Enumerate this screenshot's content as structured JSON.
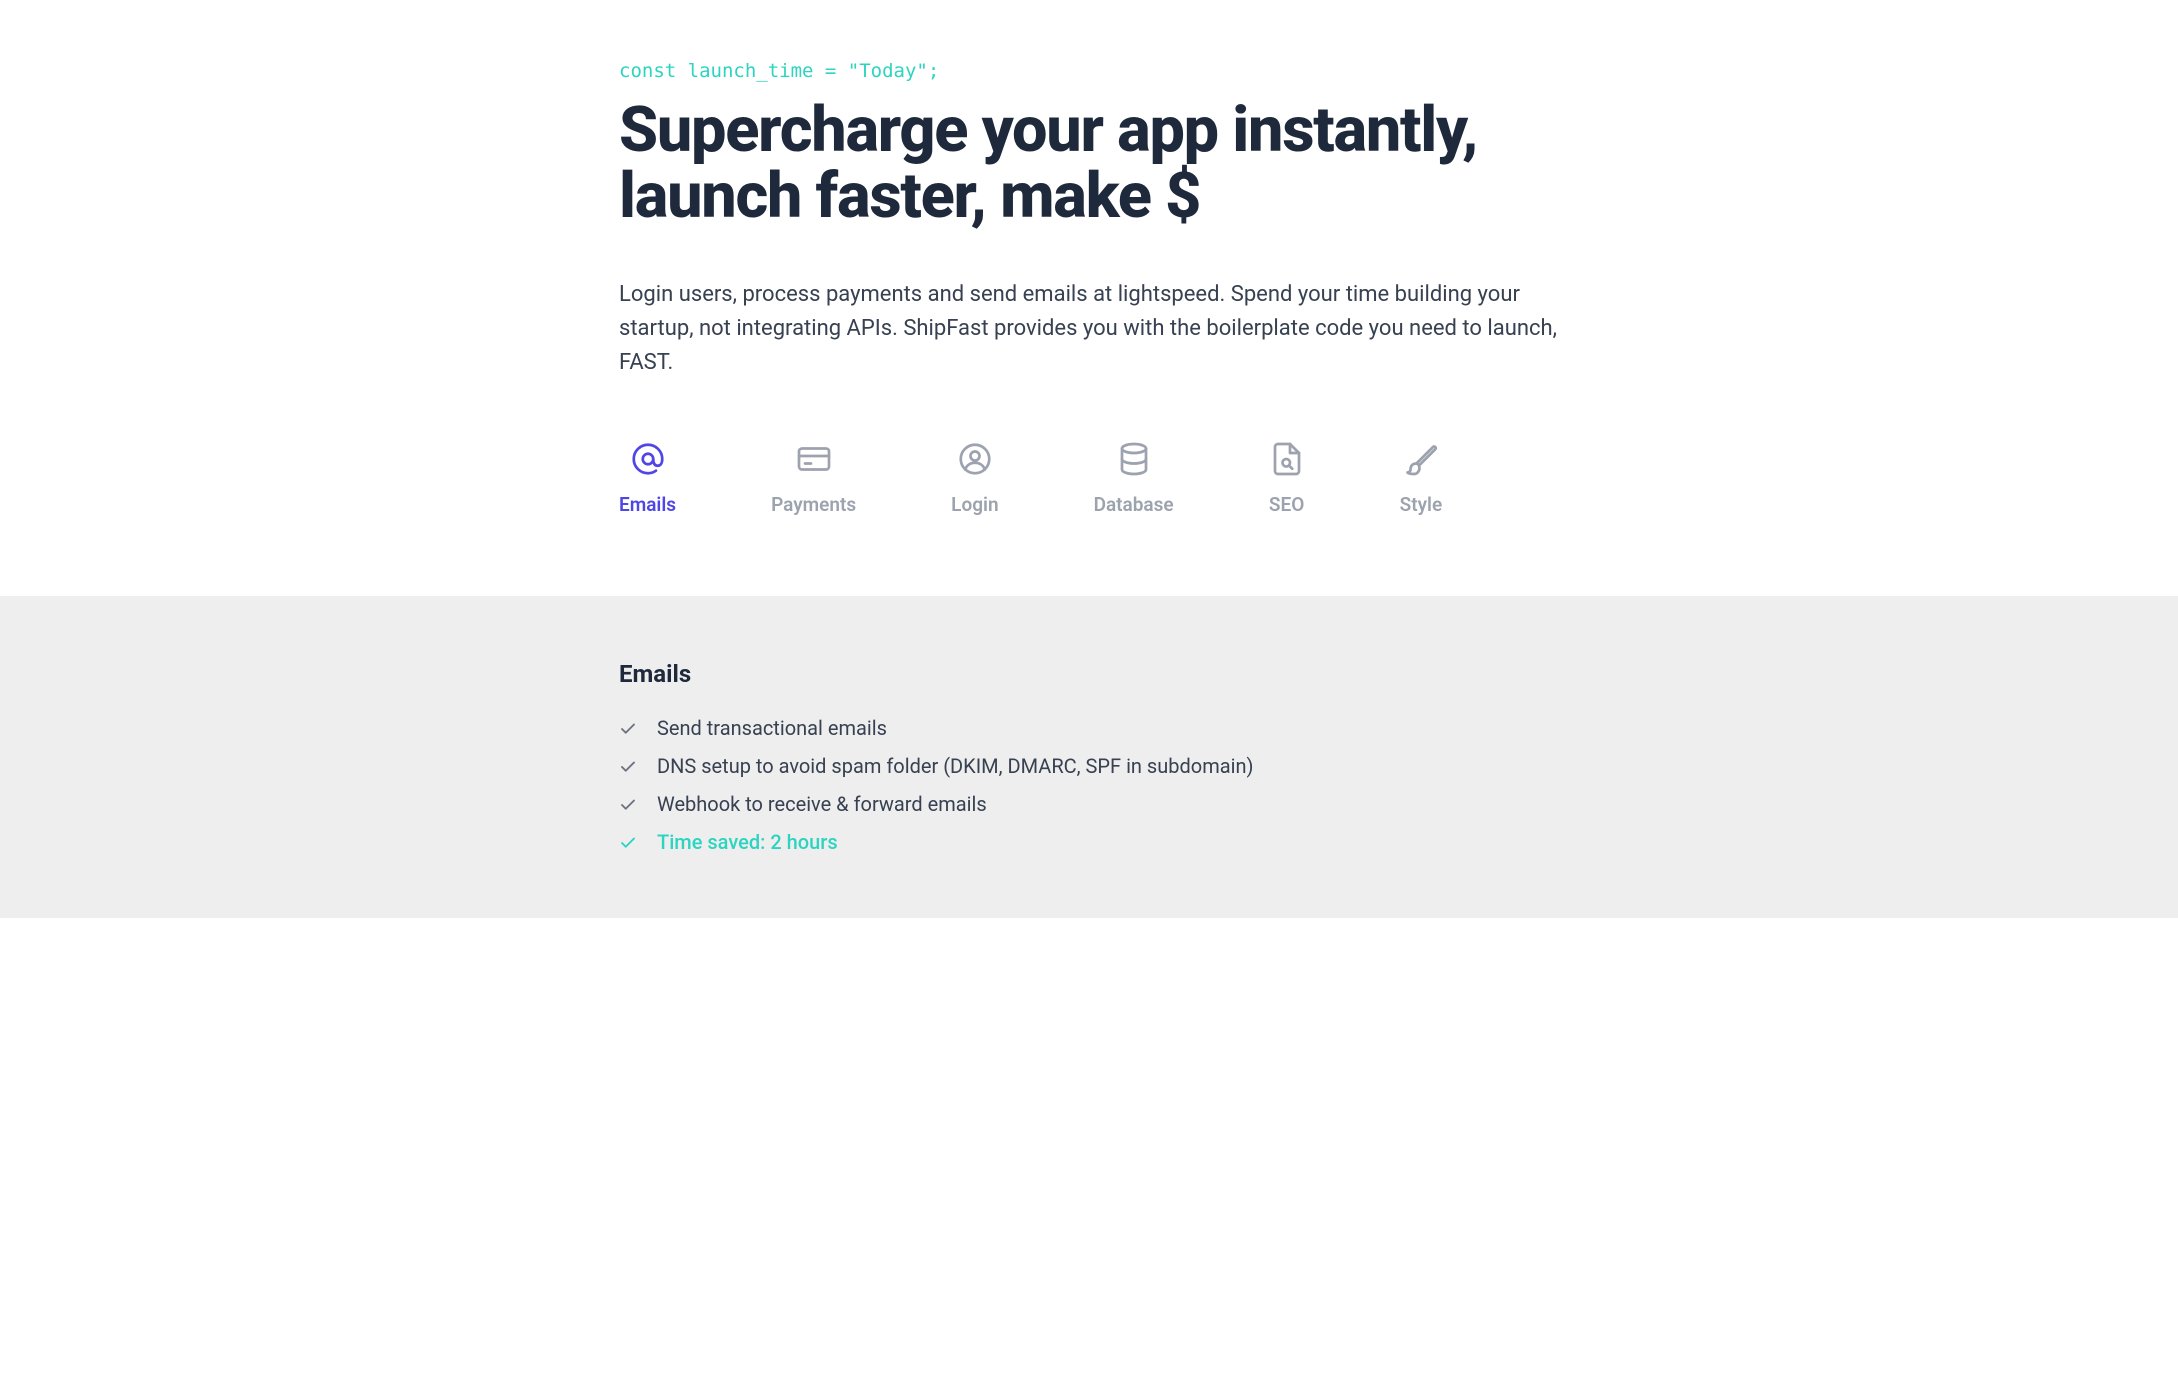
{
  "hero": {
    "code_line": "const launch_time = \"Today\";",
    "headline": "Supercharge your app instantly, launch faster, make $",
    "description": "Login users, process payments and send emails at lightspeed. Spend your time building your startup, not integrating APIs. ShipFast provides you with the boilerplate code you need to launch, FAST."
  },
  "tabs": [
    {
      "label": "Emails",
      "icon": "at-icon",
      "active": true
    },
    {
      "label": "Payments",
      "icon": "credit-card-icon",
      "active": false
    },
    {
      "label": "Login",
      "icon": "user-icon",
      "active": false
    },
    {
      "label": "Database",
      "icon": "database-icon",
      "active": false
    },
    {
      "label": "SEO",
      "icon": "document-search-icon",
      "active": false
    },
    {
      "label": "Style",
      "icon": "brush-icon",
      "active": false
    }
  ],
  "details": {
    "title": "Emails",
    "features": [
      {
        "text": "Send transactional emails",
        "highlight": false
      },
      {
        "text": "DNS setup to avoid spam folder (DKIM, DMARC, SPF in subdomain)",
        "highlight": false
      },
      {
        "text": "Webhook to receive & forward emails",
        "highlight": false
      },
      {
        "text": "Time saved: 2 hours",
        "highlight": true
      }
    ]
  },
  "colors": {
    "accent": "#4f46e5",
    "teal": "#2dd4bf",
    "muted": "#9ca3af",
    "text": "#374151",
    "heading": "#1e293b",
    "panel_bg": "#eeeeee"
  }
}
